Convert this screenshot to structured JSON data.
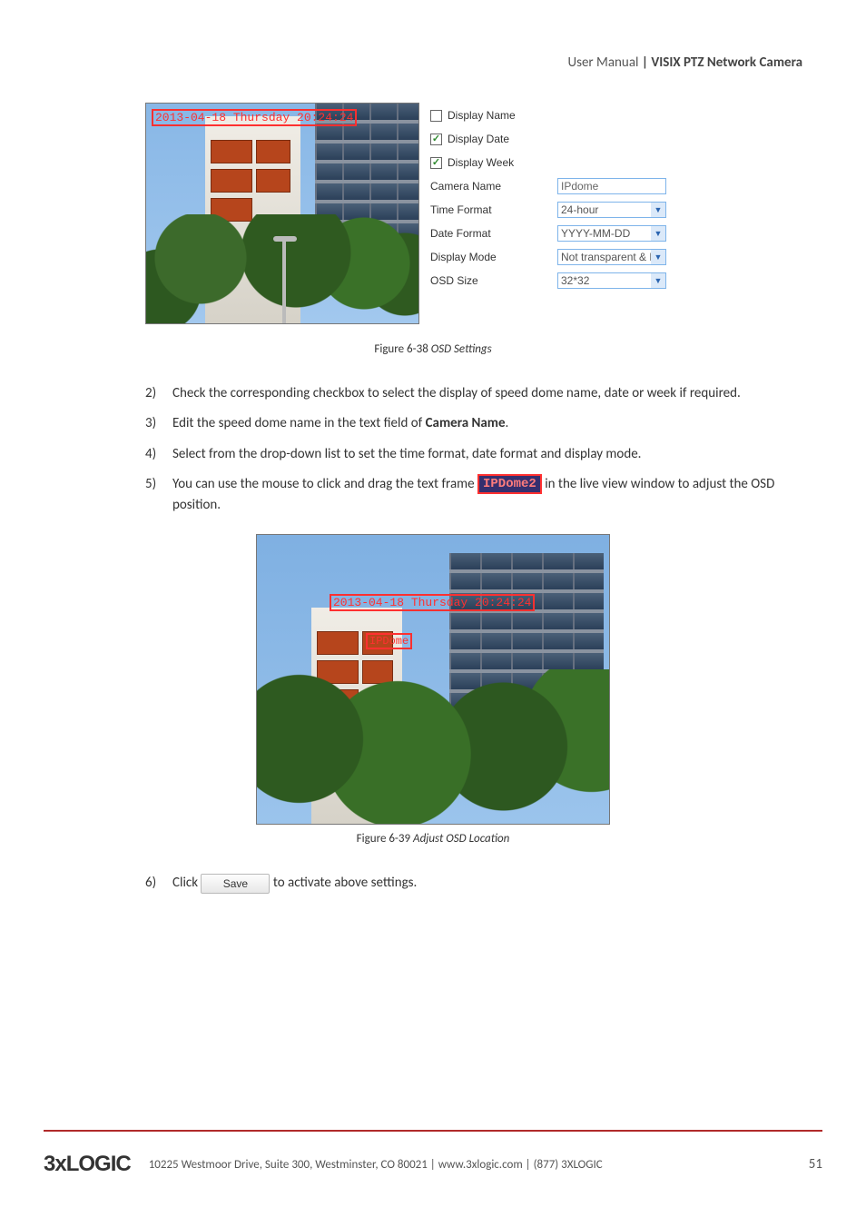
{
  "header": {
    "left": "User Manual",
    "right": "| VISIX PTZ Network Camera"
  },
  "osd": {
    "timestamp": "2013-04-18 Thursday 20:24:24",
    "display_name_label": "Display Name",
    "display_date_label": "Display Date",
    "display_week_label": "Display Week",
    "camera_name_label": "Camera Name",
    "camera_name_value": "IPdome",
    "time_format_label": "Time Format",
    "time_format_value": "24-hour",
    "date_format_label": "Date Format",
    "date_format_value": "YYYY-MM-DD",
    "display_mode_label": "Display Mode",
    "display_mode_value": "Not transparent & Not flash",
    "osd_size_label": "OSD Size",
    "osd_size_value": "32*32"
  },
  "fig1": {
    "label": "Figure 6-38",
    "title": "OSD Settings"
  },
  "fig2": {
    "label": "Figure 6-39",
    "title": "Adjust OSD Location"
  },
  "steps": {
    "s2_num": "2)",
    "s2": "Check the corresponding checkbox to select the display of speed dome name, date or week if required.",
    "s3_num": "3)",
    "s3_a": "Edit the speed dome name in the text field of ",
    "s3_b": "Camera Name",
    "s3_c": ".",
    "s4_num": "4)",
    "s4": "Select from the drop-down list to set the time format, date format and display mode.",
    "s5_num": "5)",
    "s5_a": "You can use the mouse to click and drag the text frame ",
    "s5_chip": "IPDome2",
    "s5_b": " in the live view window to adjust the OSD position.",
    "s6_num": "6)",
    "s6_a": "Click ",
    "s6_btn": "Save",
    "s6_b": " to activate above settings."
  },
  "preview2": {
    "timestamp": "2013-04-18 Thursday 20:24:24",
    "namebox": "IPDome"
  },
  "footer": {
    "brand_a": "3x",
    "brand_b": "LOGIC",
    "address": "10225 Westmoor Drive, Suite 300, Westminster, CO 80021 | www.3xlogic.com | (877) 3XLOGIC",
    "page": "51"
  }
}
